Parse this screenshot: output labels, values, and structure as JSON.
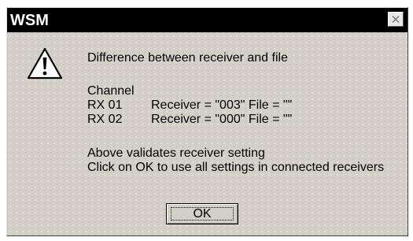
{
  "window": {
    "title": "WSM",
    "close_icon": "close-icon"
  },
  "dialog": {
    "icon": "warning-icon",
    "message": "Difference between receiver and file",
    "channel_header": "Channel",
    "rows": [
      {
        "rx": "RX 01",
        "detail": "Receiver = \"003\" File = \"\""
      },
      {
        "rx": "RX 02",
        "detail": "Receiver = \"000\" File = \"\""
      }
    ],
    "note_line1": "Above validates receiver setting",
    "note_line2": "Click on OK to use all settings in connected receivers",
    "ok_label": "OK"
  }
}
